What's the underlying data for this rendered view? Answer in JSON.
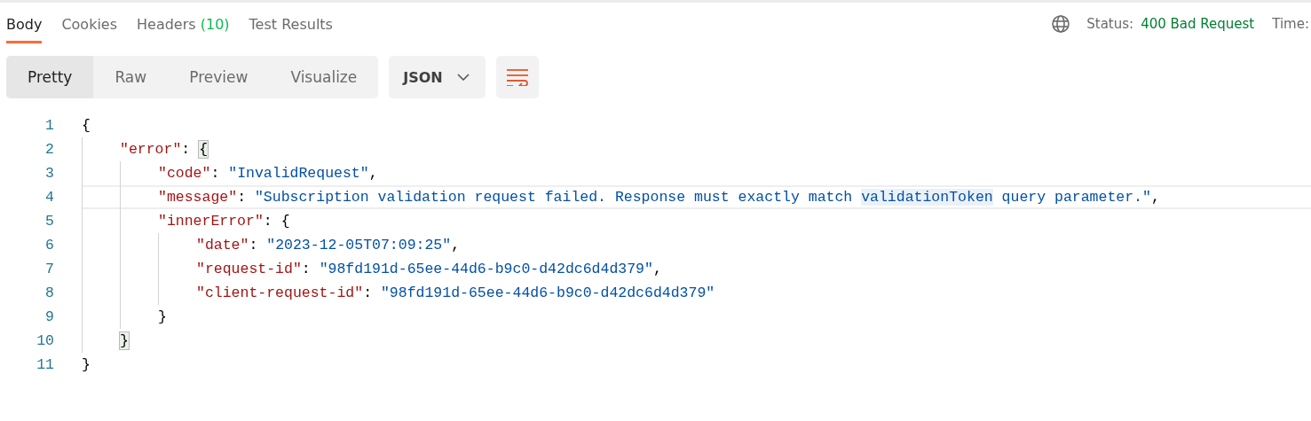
{
  "tabs": [
    {
      "label": "Body",
      "selected": true
    },
    {
      "label": "Cookies",
      "selected": false
    },
    {
      "label": "Headers",
      "count": "(10)",
      "selected": false
    },
    {
      "label": "Test Results",
      "selected": false
    }
  ],
  "status": {
    "label": "Status:",
    "value": "400 Bad Request",
    "time_label": "Time:"
  },
  "view_modes": [
    {
      "label": "Pretty",
      "selected": true
    },
    {
      "label": "Raw",
      "selected": false
    },
    {
      "label": "Preview",
      "selected": false
    },
    {
      "label": "Visualize",
      "selected": false
    }
  ],
  "format": "JSON",
  "code": {
    "lines": [
      {
        "number": "1",
        "tokens": [
          {
            "kind": "punct",
            "text": "{"
          }
        ],
        "current": false,
        "children": [
          {
            "number": "2",
            "tokens": [
              {
                "kind": "key",
                "text": "\"error\""
              },
              {
                "kind": "punct",
                "text": ": "
              },
              {
                "kind": "bracket-match",
                "text": "{"
              }
            ],
            "current": false,
            "children": [
              {
                "number": "3",
                "tokens": [
                  {
                    "kind": "key",
                    "text": "\"code\""
                  },
                  {
                    "kind": "punct",
                    "text": ": "
                  },
                  {
                    "kind": "string",
                    "text": "\"InvalidRequest\""
                  },
                  {
                    "kind": "punct",
                    "text": ","
                  }
                ],
                "current": false
              },
              {
                "number": "4",
                "tokens": [
                  {
                    "kind": "key",
                    "text": "\"message\""
                  },
                  {
                    "kind": "punct",
                    "text": ": "
                  },
                  {
                    "kind": "string",
                    "text": "\"Subscription validation request failed. Response must exactly match "
                  },
                  {
                    "kind": "string-match",
                    "text": "validationToken"
                  },
                  {
                    "kind": "string",
                    "text": " query parameter.\""
                  },
                  {
                    "kind": "punct",
                    "text": ","
                  }
                ],
                "current": true
              },
              {
                "number": "5",
                "tokens": [
                  {
                    "kind": "key",
                    "text": "\"innerError\""
                  },
                  {
                    "kind": "punct",
                    "text": ": {"
                  }
                ],
                "current": false,
                "children": [
                  {
                    "number": "6",
                    "tokens": [
                      {
                        "kind": "key",
                        "text": "\"date\""
                      },
                      {
                        "kind": "punct",
                        "text": ": "
                      },
                      {
                        "kind": "string",
                        "text": "\"2023-12-05T07:09:25\""
                      },
                      {
                        "kind": "punct",
                        "text": ","
                      }
                    ],
                    "current": false
                  },
                  {
                    "number": "7",
                    "tokens": [
                      {
                        "kind": "key",
                        "text": "\"request-id\""
                      },
                      {
                        "kind": "punct",
                        "text": ": "
                      },
                      {
                        "kind": "string",
                        "text": "\"98fd191d-65ee-44d6-b9c0-d42dc6d4d379\""
                      },
                      {
                        "kind": "punct",
                        "text": ","
                      }
                    ],
                    "current": false
                  },
                  {
                    "number": "8",
                    "tokens": [
                      {
                        "kind": "key",
                        "text": "\"client-request-id\""
                      },
                      {
                        "kind": "punct",
                        "text": ": "
                      },
                      {
                        "kind": "string",
                        "text": "\"98fd191d-65ee-44d6-b9c0-d42dc6d4d379\""
                      }
                    ],
                    "current": false
                  }
                ]
              },
              {
                "number": "9",
                "tokens": [
                  {
                    "kind": "punct",
                    "text": "}"
                  }
                ],
                "current": false
              }
            ]
          },
          {
            "number": "10",
            "tokens": [
              {
                "kind": "bracket-match",
                "text": "}"
              }
            ],
            "current": false
          }
        ]
      },
      {
        "number": "11",
        "tokens": [
          {
            "kind": "punct",
            "text": "}"
          }
        ],
        "current": false
      }
    ]
  }
}
